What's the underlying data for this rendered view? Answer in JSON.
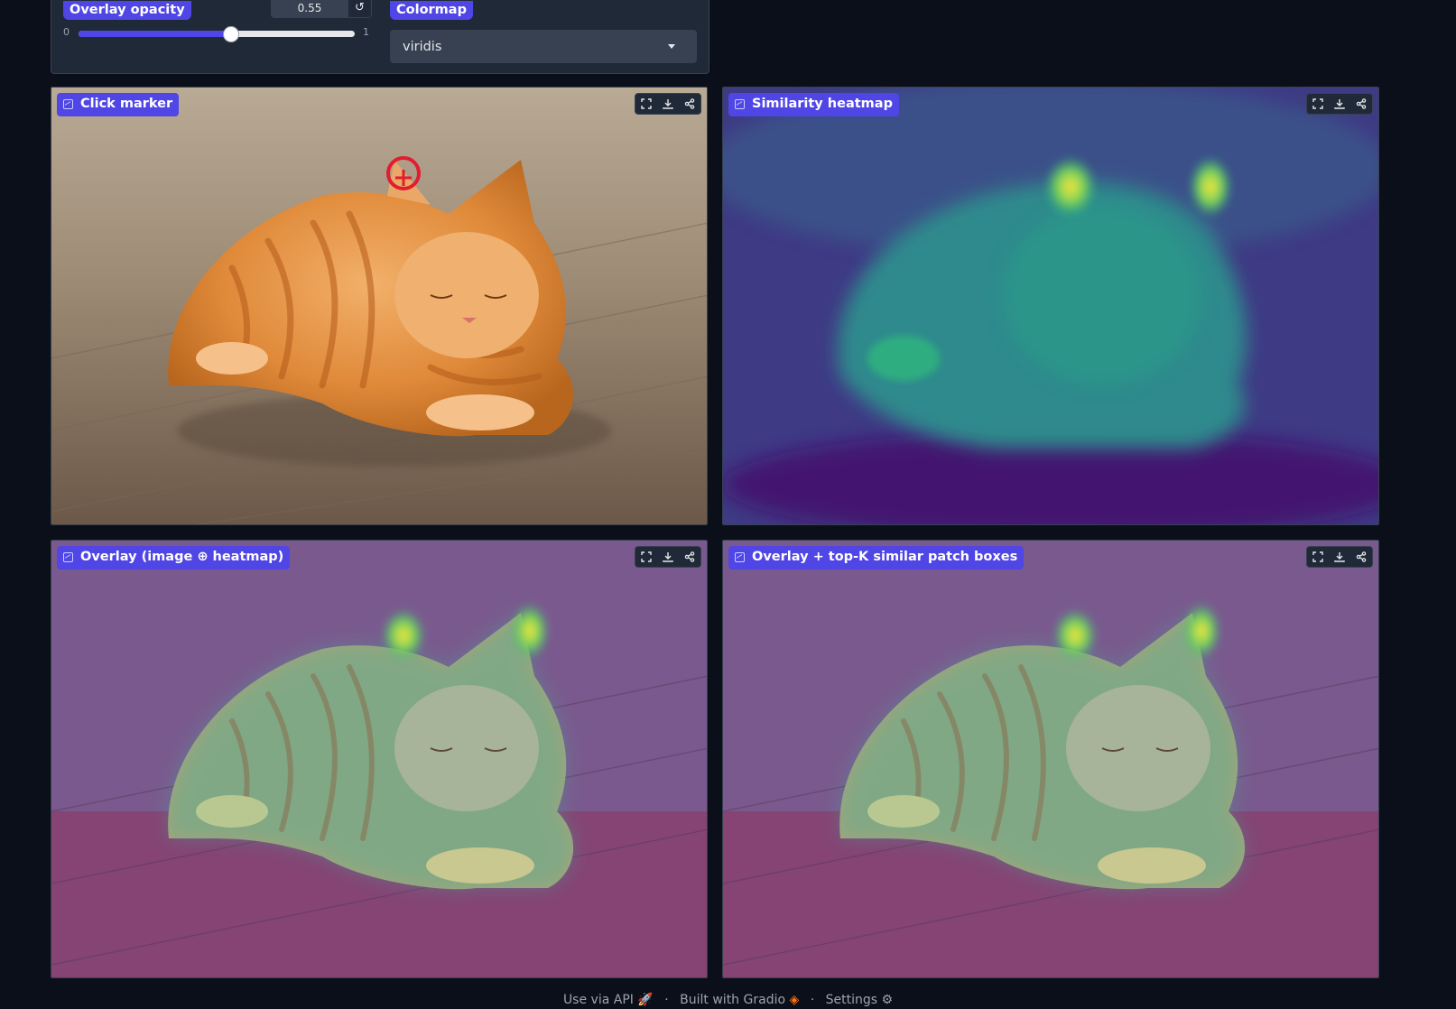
{
  "controls": {
    "opacity": {
      "label": "Overlay opacity",
      "value": "0.55",
      "fraction": 0.55,
      "min": "0",
      "max": "1",
      "reset_icon": "reset-icon"
    },
    "colormap": {
      "label": "Colormap",
      "selected": "viridis",
      "caret_icon": "chevron-down-icon"
    }
  },
  "panels": {
    "click_marker": {
      "label": "Click marker"
    },
    "similarity": {
      "label": "Similarity heatmap"
    },
    "overlay": {
      "label": "Overlay (image ⊕ heatmap)"
    },
    "overlay_topk": {
      "label": "Overlay + top-K similar patch boxes"
    }
  },
  "toolbar_icons": [
    "fullscreen-icon",
    "download-icon",
    "share-icon"
  ],
  "footer": {
    "api": "Use via API",
    "built": "Built with Gradio",
    "settings": "Settings",
    "separator": "·"
  },
  "colors": {
    "accent": "#4f46e5",
    "background": "#0b0f19",
    "marker": "#e11d2f"
  }
}
